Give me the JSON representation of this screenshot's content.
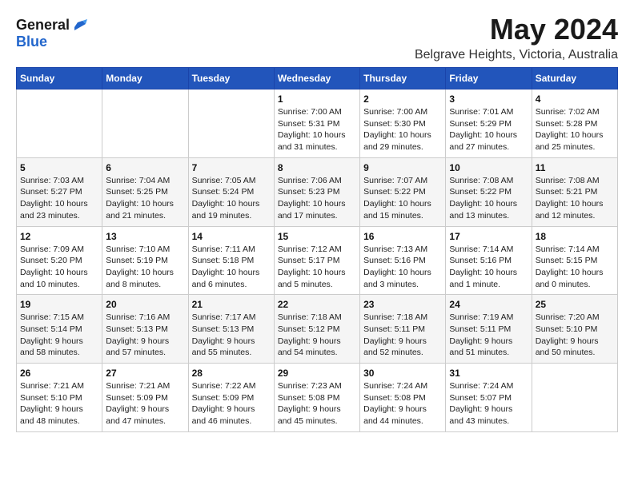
{
  "logo": {
    "general": "General",
    "blue": "Blue"
  },
  "title": "May 2024",
  "subtitle": "Belgrave Heights, Victoria, Australia",
  "days_header": [
    "Sunday",
    "Monday",
    "Tuesday",
    "Wednesday",
    "Thursday",
    "Friday",
    "Saturday"
  ],
  "weeks": [
    [
      {
        "day": "",
        "info": ""
      },
      {
        "day": "",
        "info": ""
      },
      {
        "day": "",
        "info": ""
      },
      {
        "day": "1",
        "info": "Sunrise: 7:00 AM\nSunset: 5:31 PM\nDaylight: 10 hours\nand 31 minutes."
      },
      {
        "day": "2",
        "info": "Sunrise: 7:00 AM\nSunset: 5:30 PM\nDaylight: 10 hours\nand 29 minutes."
      },
      {
        "day": "3",
        "info": "Sunrise: 7:01 AM\nSunset: 5:29 PM\nDaylight: 10 hours\nand 27 minutes."
      },
      {
        "day": "4",
        "info": "Sunrise: 7:02 AM\nSunset: 5:28 PM\nDaylight: 10 hours\nand 25 minutes."
      }
    ],
    [
      {
        "day": "5",
        "info": "Sunrise: 7:03 AM\nSunset: 5:27 PM\nDaylight: 10 hours\nand 23 minutes."
      },
      {
        "day": "6",
        "info": "Sunrise: 7:04 AM\nSunset: 5:25 PM\nDaylight: 10 hours\nand 21 minutes."
      },
      {
        "day": "7",
        "info": "Sunrise: 7:05 AM\nSunset: 5:24 PM\nDaylight: 10 hours\nand 19 minutes."
      },
      {
        "day": "8",
        "info": "Sunrise: 7:06 AM\nSunset: 5:23 PM\nDaylight: 10 hours\nand 17 minutes."
      },
      {
        "day": "9",
        "info": "Sunrise: 7:07 AM\nSunset: 5:22 PM\nDaylight: 10 hours\nand 15 minutes."
      },
      {
        "day": "10",
        "info": "Sunrise: 7:08 AM\nSunset: 5:22 PM\nDaylight: 10 hours\nand 13 minutes."
      },
      {
        "day": "11",
        "info": "Sunrise: 7:08 AM\nSunset: 5:21 PM\nDaylight: 10 hours\nand 12 minutes."
      }
    ],
    [
      {
        "day": "12",
        "info": "Sunrise: 7:09 AM\nSunset: 5:20 PM\nDaylight: 10 hours\nand 10 minutes."
      },
      {
        "day": "13",
        "info": "Sunrise: 7:10 AM\nSunset: 5:19 PM\nDaylight: 10 hours\nand 8 minutes."
      },
      {
        "day": "14",
        "info": "Sunrise: 7:11 AM\nSunset: 5:18 PM\nDaylight: 10 hours\nand 6 minutes."
      },
      {
        "day": "15",
        "info": "Sunrise: 7:12 AM\nSunset: 5:17 PM\nDaylight: 10 hours\nand 5 minutes."
      },
      {
        "day": "16",
        "info": "Sunrise: 7:13 AM\nSunset: 5:16 PM\nDaylight: 10 hours\nand 3 minutes."
      },
      {
        "day": "17",
        "info": "Sunrise: 7:14 AM\nSunset: 5:16 PM\nDaylight: 10 hours\nand 1 minute."
      },
      {
        "day": "18",
        "info": "Sunrise: 7:14 AM\nSunset: 5:15 PM\nDaylight: 10 hours\nand 0 minutes."
      }
    ],
    [
      {
        "day": "19",
        "info": "Sunrise: 7:15 AM\nSunset: 5:14 PM\nDaylight: 9 hours\nand 58 minutes."
      },
      {
        "day": "20",
        "info": "Sunrise: 7:16 AM\nSunset: 5:13 PM\nDaylight: 9 hours\nand 57 minutes."
      },
      {
        "day": "21",
        "info": "Sunrise: 7:17 AM\nSunset: 5:13 PM\nDaylight: 9 hours\nand 55 minutes."
      },
      {
        "day": "22",
        "info": "Sunrise: 7:18 AM\nSunset: 5:12 PM\nDaylight: 9 hours\nand 54 minutes."
      },
      {
        "day": "23",
        "info": "Sunrise: 7:18 AM\nSunset: 5:11 PM\nDaylight: 9 hours\nand 52 minutes."
      },
      {
        "day": "24",
        "info": "Sunrise: 7:19 AM\nSunset: 5:11 PM\nDaylight: 9 hours\nand 51 minutes."
      },
      {
        "day": "25",
        "info": "Sunrise: 7:20 AM\nSunset: 5:10 PM\nDaylight: 9 hours\nand 50 minutes."
      }
    ],
    [
      {
        "day": "26",
        "info": "Sunrise: 7:21 AM\nSunset: 5:10 PM\nDaylight: 9 hours\nand 48 minutes."
      },
      {
        "day": "27",
        "info": "Sunrise: 7:21 AM\nSunset: 5:09 PM\nDaylight: 9 hours\nand 47 minutes."
      },
      {
        "day": "28",
        "info": "Sunrise: 7:22 AM\nSunset: 5:09 PM\nDaylight: 9 hours\nand 46 minutes."
      },
      {
        "day": "29",
        "info": "Sunrise: 7:23 AM\nSunset: 5:08 PM\nDaylight: 9 hours\nand 45 minutes."
      },
      {
        "day": "30",
        "info": "Sunrise: 7:24 AM\nSunset: 5:08 PM\nDaylight: 9 hours\nand 44 minutes."
      },
      {
        "day": "31",
        "info": "Sunrise: 7:24 AM\nSunset: 5:07 PM\nDaylight: 9 hours\nand 43 minutes."
      },
      {
        "day": "",
        "info": ""
      }
    ]
  ]
}
